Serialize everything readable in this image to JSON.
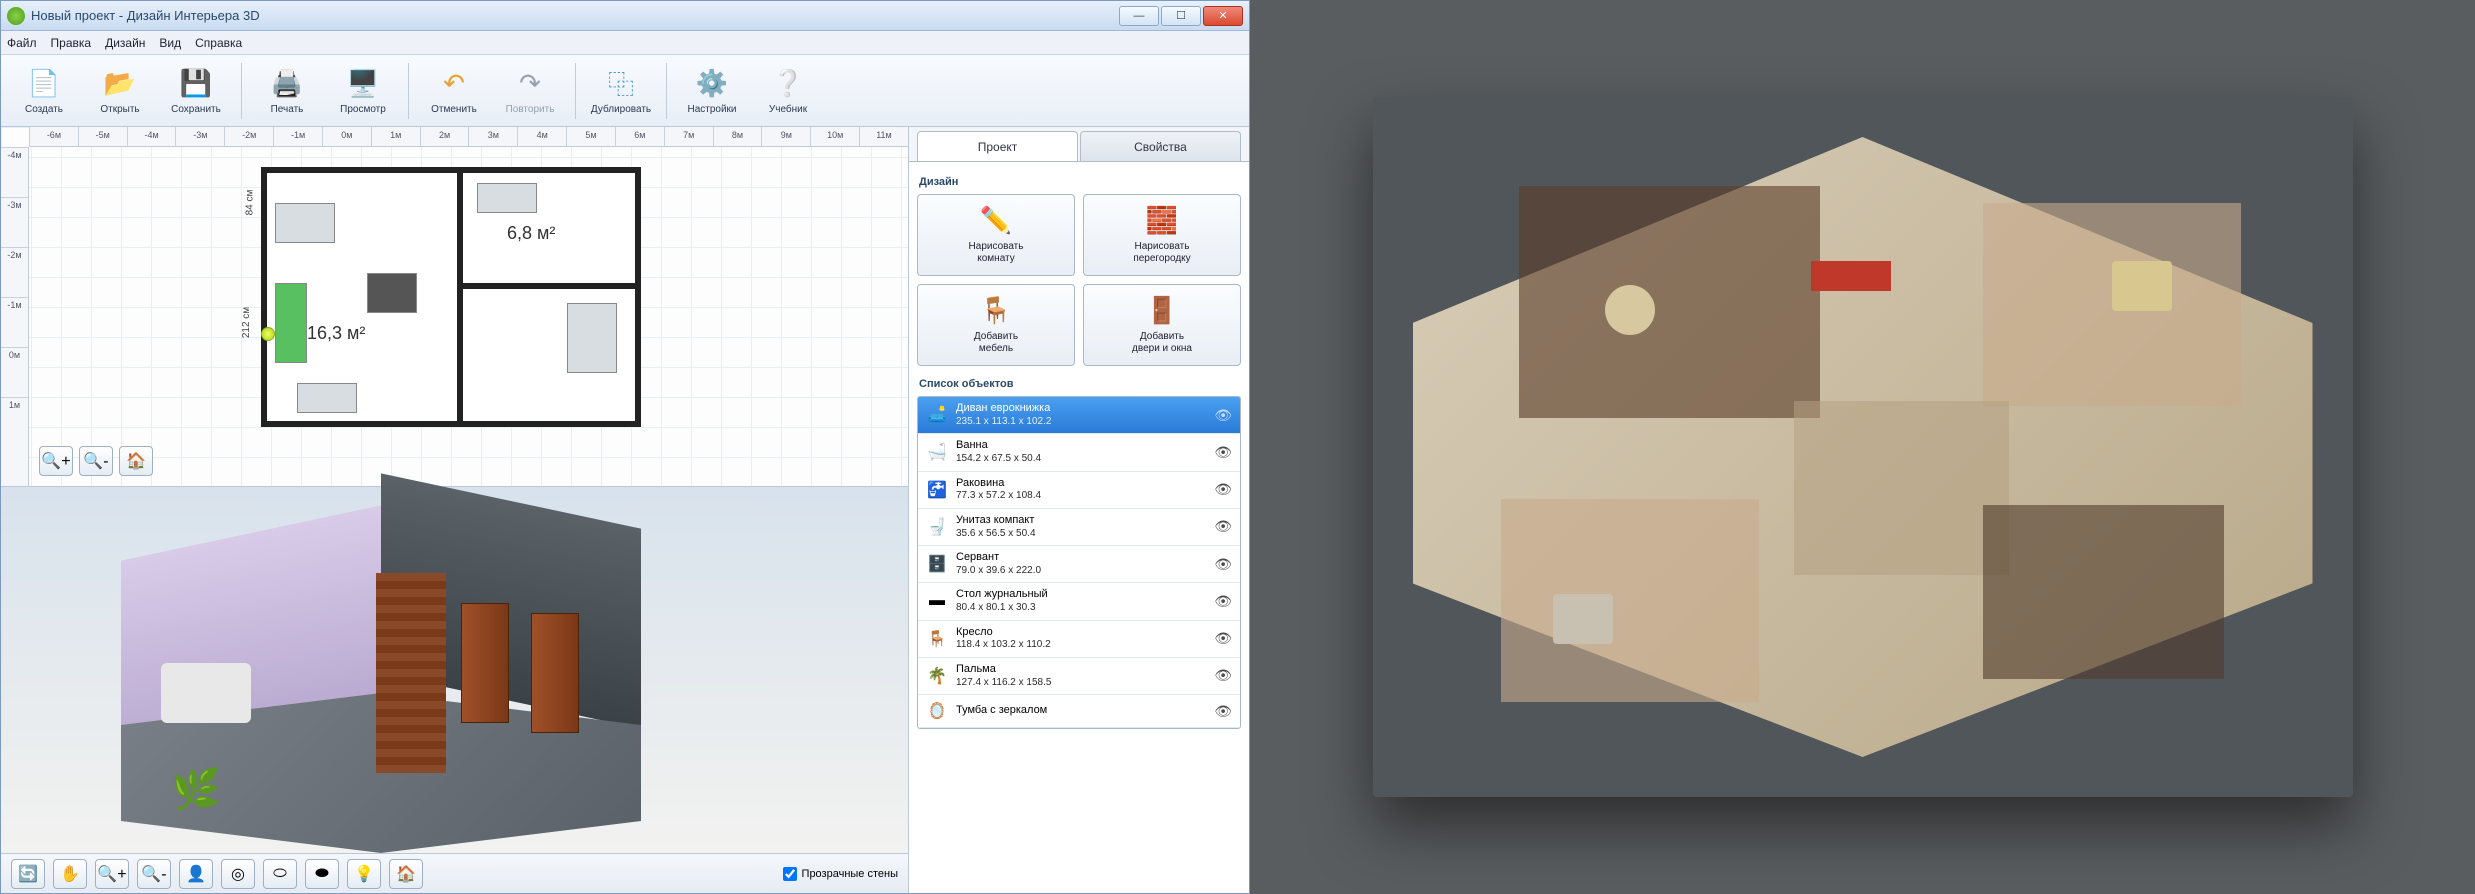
{
  "window": {
    "title": "Новый проект - Дизайн Интерьера 3D"
  },
  "menus": [
    "Файл",
    "Правка",
    "Дизайн",
    "Вид",
    "Справка"
  ],
  "toolbar": {
    "create": "Создать",
    "open": "Открыть",
    "save": "Сохранить",
    "print": "Печать",
    "preview": "Просмотр",
    "undo": "Отменить",
    "redo": "Повторить",
    "duplicate": "Дублировать",
    "settings": "Настройки",
    "tutorial": "Учебник"
  },
  "ruler_h": [
    "-6м",
    "-5м",
    "-4м",
    "-3м",
    "-2м",
    "-1м",
    "0м",
    "1м",
    "2м",
    "3м",
    "4м",
    "5м",
    "6м",
    "7м",
    "8м",
    "9м",
    "10м",
    "11м"
  ],
  "ruler_v": [
    "-4м",
    "-3м",
    "-2м",
    "-1м",
    "0м",
    "1м"
  ],
  "rooms": {
    "r1_area": "16,3 м²",
    "r2_area": "6,8 м²"
  },
  "dims": {
    "w212": "212 см",
    "w84": "84 см"
  },
  "tabs": {
    "project": "Проект",
    "properties": "Свойства"
  },
  "panel": {
    "design_title": "Дизайн",
    "draw_room": "Нарисовать\nкомнату",
    "draw_partition": "Нарисовать\nперегородку",
    "add_furniture": "Добавить\nмебель",
    "add_doors": "Добавить\nдвери и окна",
    "objects_title": "Список объектов"
  },
  "objects": [
    {
      "name": "Диван еврокнижка",
      "dims": "235.1 x 113.1 x 102.2",
      "icon": "🛋️",
      "selected": true
    },
    {
      "name": "Ванна",
      "dims": "154.2 x 67.5 x 50.4",
      "icon": "🛁",
      "selected": false
    },
    {
      "name": "Раковина",
      "dims": "77.3 x 57.2 x 108.4",
      "icon": "🚰",
      "selected": false
    },
    {
      "name": "Унитаз компакт",
      "dims": "35.6 x 56.5 x 50.4",
      "icon": "🚽",
      "selected": false
    },
    {
      "name": "Сервант",
      "dims": "79.0 x 39.6 x 222.0",
      "icon": "🗄️",
      "selected": false
    },
    {
      "name": "Стол журнальный",
      "dims": "80.4 x 80.1 x 30.3",
      "icon": "▬",
      "selected": false
    },
    {
      "name": "Кресло",
      "dims": "118.4 x 103.2 x 110.2",
      "icon": "🪑",
      "selected": false
    },
    {
      "name": "Пальма",
      "dims": "127.4 x 116.2 x 158.5",
      "icon": "🌴",
      "selected": false
    },
    {
      "name": "Тумба с зеркалом",
      "dims": "",
      "icon": "🪞",
      "selected": false
    }
  ],
  "bottom": {
    "transparent_walls": "Прозрачные стены"
  }
}
